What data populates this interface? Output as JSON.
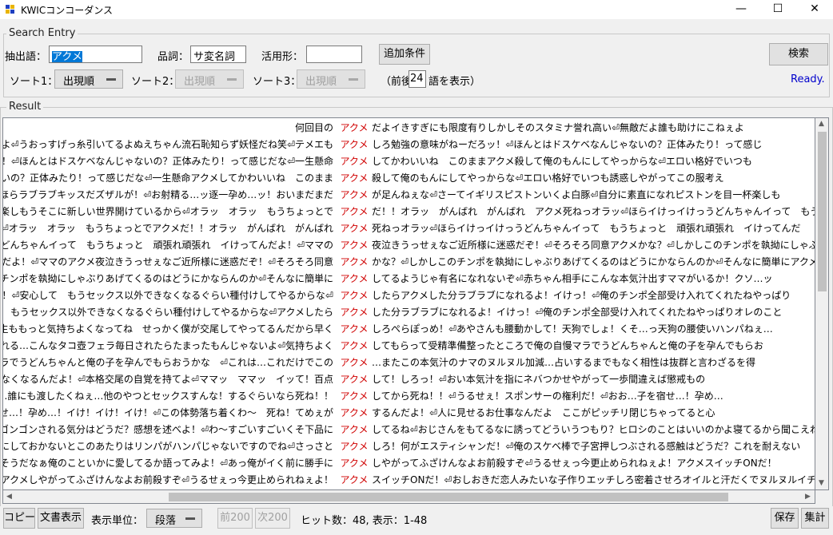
{
  "window": {
    "title": "KWICコンコーダンス",
    "controls": {
      "minimize": "—",
      "maximize": "☐",
      "close": "✕"
    }
  },
  "search": {
    "legend": "Search Entry",
    "extract_label": "抽出語：",
    "extract_value": "アクメ",
    "pos_label": "品詞：",
    "pos_value": "サ変名詞",
    "conj_label": "活用形：",
    "conj_value": "",
    "add_condition": "追加条件",
    "search_button": "検索",
    "sort1_label": "ソート1：",
    "sort1_value": "出現順",
    "sort2_label": "ソート2：",
    "sort2_value": "出現順",
    "sort3_label": "ソート3：",
    "sort3_value": "出現順",
    "context_prefix": "（前後",
    "context_value": "24",
    "context_suffix": "語を表示）",
    "status": "Ready."
  },
  "result": {
    "legend": "Result",
    "rows": [
      {
        "left": "何回目の",
        "kw": "アクメ",
        "right": "だよイきすぎにも限度有りしかしそのスタミナ誉れ高い⏎無敵だよ誰も助けにこねぇよ"
      },
      {
        "left": "得点だよ⏎うおっすげっ糸引いてるよぬえちゃん流石恥知らず妖怪だね笑⏎テメエも",
        "kw": "アクメ",
        "right": "しろ勉強の意味がねーだろッ！⏎ほんとはドスケベなんじゃないの？正体みたり！って感じ"
      },
      {
        "left": "だろッ！⏎ほんとはドスケベなんじゃないの？正体みたり！って感じだな⏎一生懸命",
        "kw": "アクメ",
        "right": "してかわいいね　このままアクメ殺して俺のもんにしてやっからな⏎エロい格好でいつも"
      },
      {
        "left": "じゃないの？正体みたり！って感じだな⏎一生懸命アクメしてかわいいね　このまま",
        "kw": "アクメ",
        "right": "殺して俺のもんにしてやっからな⏎エロい格好でいつも誘惑しやがってこの服考え"
      },
      {
        "left": "ね⏎ほらラブラブキッスだズザルが！⏎お射精る…ッ逐一孕め…ッ！おいまだまだ",
        "kw": "アクメ",
        "right": "が足んねぇな⏎さーてイギリスピストンいくよ白豚⏎自分に素直になれピストンを目一杯楽しも"
      },
      {
        "left": "ンを目一杯楽しもうそこに新しい世界開けているから⏎オラッ　オラッ　もうちょっとで",
        "kw": "アクメ",
        "right": "だ！！オラッ　がんばれ　がんばれ　アクメ死ねっオラッ⏎ほらイけっイけっうどんちゃんイって　もう"
      },
      {
        "left": "ているから⏎オラッ　オラッ　もうちょっとでアクメだ！！オラッ　がんばれ　がんばれ",
        "kw": "アクメ",
        "right": "死ねっオラッ⏎ほらイけっイけっうどんちゃんイって　もうちょっと　頑張れ頑張れ　イけってんだ"
      },
      {
        "left": "イけっうどんちゃんイって　もうちょっと　頑張れ頑張れ　イけってんだよ！⏎ママの",
        "kw": "アクメ",
        "right": "夜泣きうっせぇなご近所様に迷惑だぞ！⏎そろそろ同意アクメかな？⏎しかしこのチンポを執拗にしゃぶりあげてく"
      },
      {
        "left": "ってんだよ！⏎ママのアクメ夜泣きうっせぇなご近所様に迷惑だぞ！⏎そろそろ同意",
        "kw": "アクメ",
        "right": "かな？⏎しかしこのチンポを執拗にしゃぶりあげてくるのはどうにかならんのか⏎そんなに簡単にアクメしてるようじゃ"
      },
      {
        "left": "しかしこのチンポを執拗にしゃぶりあげてくるのはどうにかならんのか⏎そんなに簡単に",
        "kw": "アクメ",
        "right": "してるようじゃ有名になれないぞ⏎赤ちゃん相手にこんな本気汁出すママがいるか！クソ…ッ"
      },
      {
        "left": "受付取れ！⏎安心して　もうセックス以外できなくなるぐらい種付けしてやるからな⏎",
        "kw": "アクメ",
        "right": "したらアクメした分ラブラブになれるよ！イけっ！⏎俺のチンポ全部受け入れてくれたねやっぱり"
      },
      {
        "left": "⏎安心して　もうセックス以外できなくなるぐらい種付けしてやるからな⏎アクメしたら",
        "kw": "アクメ",
        "right": "した分ラブラブになれるよ！イけっ！⏎俺のチンポ全部受け入れてくれたねやっぱりオレのこと"
      },
      {
        "left": "きるか！先生ももっと気持ちよくなってね　せっかく僕が交尾してやってるんだから早く",
        "kw": "アクメ",
        "right": "しろぺらぽっめ！⏎あやさんも腰動かして！天狗でしょ！くそ…っ天狗の腰使いハンパねぇ…"
      },
      {
        "left": "飲み込まれる…こんなタコ壺フェラ毎日されたらたまったもんじゃないよ⏎気持ちよく",
        "kw": "アクメ",
        "right": "してもらって受精準備整ったところで俺の自慢マラでうどんちゃんと俺の子を孕んでもらお"
      },
      {
        "left": "マラでうどんちゃんと俺の子を孕んでもらおうかな　⏎これは…これだけでこの",
        "kw": "アクメ",
        "right": "…またこの本気汁のナマのヌルヌル加減…占いするまでもなく相性は抜群と言わざるを得"
      },
      {
        "left": "識できなくなるんだよ！⏎本格交尾の自覚を持てよ⏎ママッ　ママッ　イッて！百点",
        "kw": "アクメ",
        "right": "して！しろっ！⏎おい本気汁を指にネバつかせやがって一歩間違えば懲戒もの"
      },
      {
        "left": "⏎クソ…誰にも渡したくねぇ…他のやつとセックスすんな！するぐらいなら死ね！！",
        "kw": "アクメ",
        "right": "してから死ね！！⏎うるせぇ！スポンサーの権利だ！⏎おお…子を宿せ…！孕め…"
      },
      {
        "left": "宿せ…！孕め…！イけ！イけ！イけ！⏎この体勢落ち着くわ〜　死ね！てめぇが",
        "kw": "アクメ",
        "right": "するんだよ！⏎人に見せるお仕事なんだよ　ここがピッチリ閉じちゃってると心"
      },
      {
        "left": "宮をゴンゴンされる気分はどうだ？感想を述べよ！⏎わ〜すごいすごいくそ下品に",
        "kw": "アクメ",
        "right": "してるね⏎おじさんをもてるなに誘ってどういうつもり？ヒロシのことはいいのかよ寝てるから聞こえねぇ"
      },
      {
        "left": "までオイリーにしておかないとこのあたりはリンパがハンパじゃないですのでね⏎さっさと",
        "kw": "アクメ",
        "right": "しろ！何がエスティシャンだ！⏎俺のスケベ棒で子宮押しつぶされる感触はどうだ？これを耐えない"
      },
      {
        "left": "じゃねぇそうだなぁ俺のこといかに愛してるか語ってみよ！⏎あっ俺がイく前に勝手に",
        "kw": "アクメ",
        "right": "しやがってふざけんなよお前殺すぞ⏎うるせぇっ今更止められねぇよ！アクメスイッチONだ！"
      },
      {
        "left": "に勝手にアクメしやがってふざけんなよお前殺すぞ⏎うるせぇっ今更止められねぇよ！",
        "kw": "アクメ",
        "right": "スイッチONだ！⏎おしおきだ恋人みたいな子作りエッチしろ密着させろオイルと汗だくでヌルヌルイチャイチャエッチ"
      }
    ]
  },
  "footer": {
    "copy": "コピー",
    "doc_view": "文書表示",
    "unit_label": "表示単位：",
    "unit_value": "段落",
    "prev": "前200",
    "next": "次200",
    "hits": "ヒット数：48, 表示：1-48",
    "save": "保存",
    "stats": "集計"
  },
  "colors": {
    "keyword": "#d00000",
    "status": "#0000cc",
    "selection": "#0078d7"
  }
}
